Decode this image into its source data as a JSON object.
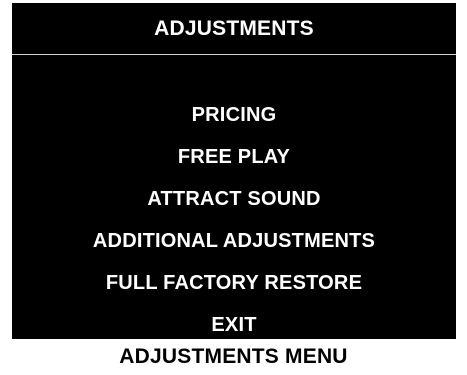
{
  "screen": {
    "title": "ADJUSTMENTS",
    "background_color": "#000000",
    "text_color": "#ffffff"
  },
  "menu": {
    "items": [
      {
        "label": "PRICING"
      },
      {
        "label": "FREE PLAY"
      },
      {
        "label": "ATTRACT SOUND"
      },
      {
        "label": "ADDITIONAL ADJUSTMENTS"
      },
      {
        "label": "FULL FACTORY RESTORE"
      },
      {
        "label": "EXIT"
      }
    ]
  },
  "caption": "ADJUSTMENTS MENU"
}
